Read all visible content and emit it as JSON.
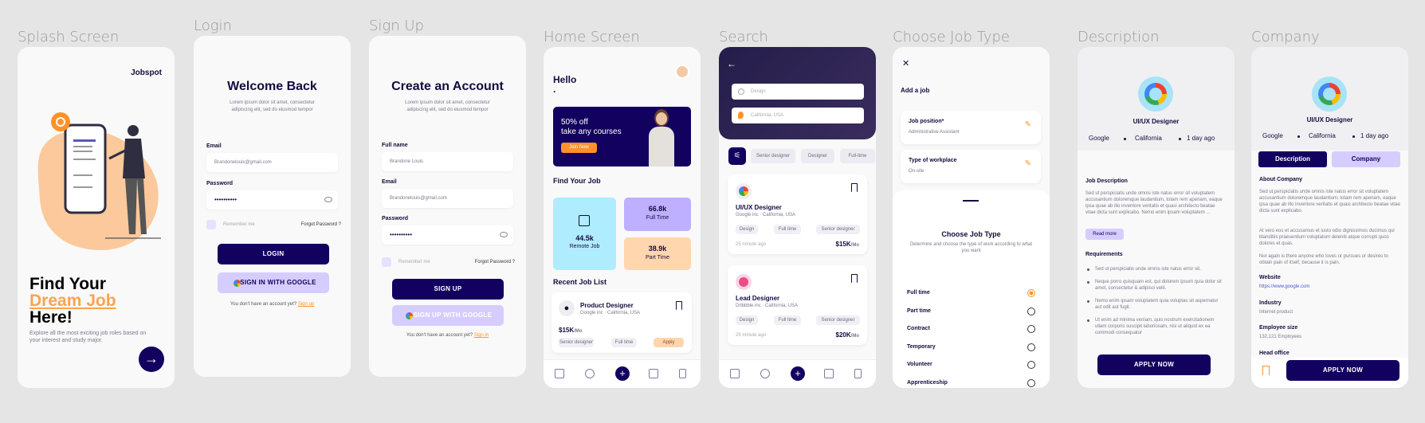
{
  "labels": {
    "splash": "Splash Screen",
    "login": "Login",
    "signup": "Sign Up",
    "home": "Home Screen",
    "search": "Search",
    "jobtype": "Choose Job Type",
    "description": "Description",
    "company": "Company"
  },
  "splash": {
    "brand": "Jobspot",
    "line1": "Find Your",
    "line2": "Dream Job",
    "line3": "Here!",
    "sub": "Explore all the most exciting job roles based on your interest and study major."
  },
  "login": {
    "title": "Welcome Back",
    "sub": "Lorem ipsum dolor sit amet, consectetur adipiscing elit, sed do eiusmod tempor",
    "email_label": "Email",
    "email_value": "Brandonelouis@gmail.com",
    "password_label": "Password",
    "password_value": "••••••••••",
    "remember": "Remember me",
    "forgot": "Forgot Password ?",
    "login_btn": "LOGIN",
    "google_btn": "SIGN IN WITH GOOGLE",
    "no_account": "You don't have an account yet?",
    "signup_link": "Sign up"
  },
  "signup": {
    "title": "Create an Account",
    "sub": "Lorem ipsum dolor sit amet, consectetur adipiscing elit, sed do eiusmod tempor",
    "name_label": "Full name",
    "name_value": "Brandone Louis",
    "email_label": "Email",
    "email_value": "Brandonelouis@gmail.com",
    "password_label": "Password",
    "password_value": "••••••••••",
    "remember": "Remember me",
    "forgot": "Forgot Password ?",
    "signup_btn": "SIGN UP",
    "google_btn": "SIGN UP WITH GOOGLE",
    "no_account": "You don't have an account yet?",
    "signin_link": "Sign in"
  },
  "home": {
    "hello": "Hello",
    "dot": ".",
    "banner_line1": "50% off",
    "banner_line2": "take any courses",
    "banner_btn": "Join Now",
    "find": "Find Your Job",
    "remote_count": "44.5k",
    "remote_label": "Remote Job",
    "full_count": "66.8k",
    "full_label": "Full Time",
    "part_count": "38.9k",
    "part_label": "Part Time",
    "recent": "Recent Job List",
    "job_title": "Product Designer",
    "job_company": "Google inc · California, USA",
    "job_salary": "$15K",
    "job_per": "/Mo",
    "chip1": "Senior designer",
    "chip2": "Full time",
    "apply": "Apply"
  },
  "search": {
    "input1": "Design",
    "input2": "California, USA",
    "filters": [
      "Senior designer",
      "Designer",
      "Full-time"
    ],
    "jobs": [
      {
        "title": "UI/UX Designer",
        "company": "Google inc · California, USA",
        "chips": [
          "Design",
          "Full time",
          "Senior designer"
        ],
        "time": "25 minute ago",
        "salary": "$15K",
        "per": "/Mo"
      },
      {
        "title": "Lead Designer",
        "company": "Dribbble inc · California, USA",
        "chips": [
          "Design",
          "Full time",
          "Senior designer"
        ],
        "time": "25 minute ago",
        "salary": "$20K",
        "per": "/Mo"
      }
    ]
  },
  "jobtype": {
    "header": "Add a job",
    "field1_label": "Job position*",
    "field1_value": "Administrative Assistant",
    "field2_label": "Type of workplace",
    "field2_value": "On-site",
    "title": "Choose Job Type",
    "sub": "Determine and choose the type of work according to what you want",
    "options": [
      "Full time",
      "Part time",
      "Contract",
      "Temporary",
      "Volunteer",
      "Apprenticeship"
    ],
    "selected": 0
  },
  "description": {
    "title": "UI/UX Designer",
    "company": "Google",
    "location": "California",
    "posted": "1 day ago",
    "section": "Job Description",
    "body": "Sed ut perspiciatis unde omnis iste natus error sit voluptatem accusantium doloremque laudantium, totam rem aperiam, eaque ipsa quae ab illo inventore veritatis et quasi architecto beatae vitae dicta sunt explicabo. Nemo enim ipsam voluptatem ...",
    "read_more": "Read more",
    "req_title": "Requirements",
    "reqs": [
      "Sed ut perspiciatis unde omnis iste natus error sit.",
      "Neque porro quisquam est, qui dolorem ipsum quia dolor sit amet, consectetur & adipisci velit.",
      "Nemo enim ipsam voluptatem quia voluptas sit aspernatur aut odit aut fugit.",
      "Ut enim ad minima veniam, quis nostrum exercitationem ullam corporis suscipit laboriosam, nisi ut aliquid ex ea commodi consequatur"
    ],
    "apply": "APPLY NOW"
  },
  "company": {
    "title": "UI/UX Designer",
    "company": "Google",
    "location": "California",
    "posted": "1 day ago",
    "tab1": "Description",
    "tab2": "Company",
    "about_title": "About Company",
    "about1": "Sed ut perspiciatis unde omnis iste natus error sit voluptatem accusantium doloremque laudantium, totam rem aperiam, eaque ipsa quae ab illo inventore veritatis et quasi architecto beatae vitae dicta sunt explicabo.",
    "about2": "At vero eos et accusamus et iusto odio dignissimos ducimus qui blanditiis praesentium voluptatum deleniti atque corrupti quos dolores et quas.",
    "about3": "Nor again is there anyone who loves or pursues or desires to obtain pain of itself, because it is pain.",
    "website_label": "Website",
    "website": "https://www.google.com",
    "industry_label": "Industry",
    "industry": "Internet product",
    "size_label": "Employee size",
    "size": "132,121 Employees",
    "head_label": "Head office",
    "apply": "APPLY NOW"
  },
  "colors": {
    "navy": "#130160",
    "orange": "#ff9228",
    "lavender": "#d6cdfe",
    "cyan": "#afecfe",
    "peach": "#ffd6ad"
  }
}
